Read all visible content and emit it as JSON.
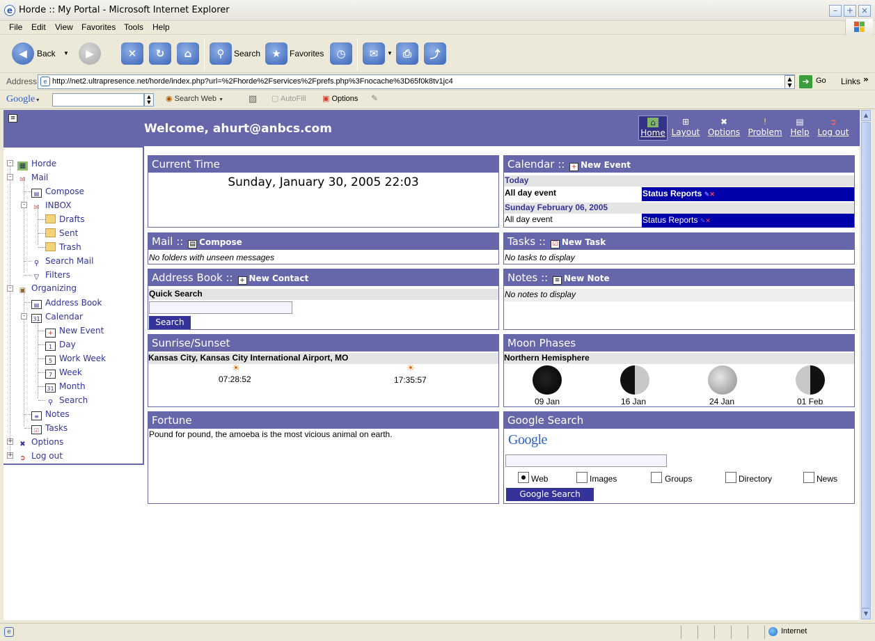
{
  "window": {
    "title": "Horde :: My Portal - Microsoft Internet Explorer"
  },
  "menu": [
    "File",
    "Edit",
    "View",
    "Favorites",
    "Tools",
    "Help"
  ],
  "toolbar": {
    "back": "Back",
    "search": "Search",
    "favorites": "Favorites"
  },
  "address": {
    "label": "Address",
    "url": "http://net2.ultrapresence.net/horde/index.php?url=%2Fhorde%2Fservices%2Fprefs.php%3Fnocache%3D65f0k8tv1jc4",
    "go": "Go",
    "links": "Links"
  },
  "googlebar": {
    "brand": "Google",
    "search_web": "Search Web",
    "autofill": "AutoFill",
    "options": "Options"
  },
  "header": {
    "welcome": "Welcome, ahurt@anbcs.com",
    "nav": [
      {
        "label": "Home",
        "icon": "home-icon"
      },
      {
        "label": "Layout",
        "icon": "layout-icon"
      },
      {
        "label": "Options",
        "icon": "options-icon"
      },
      {
        "label": "Problem",
        "icon": "problem-icon"
      },
      {
        "label": "Help",
        "icon": "help-icon"
      },
      {
        "label": "Log out",
        "icon": "logout-icon"
      }
    ]
  },
  "sidebar": {
    "items": [
      {
        "label": "Horde",
        "icon": "horde-icon"
      },
      {
        "label": "Mail",
        "icon": "mail-icon"
      },
      {
        "label": "Compose",
        "icon": "compose-icon"
      },
      {
        "label": "INBOX",
        "icon": "inbox-icon"
      },
      {
        "label": "Drafts",
        "icon": "folder-icon"
      },
      {
        "label": "Sent",
        "icon": "folder-icon"
      },
      {
        "label": "Trash",
        "icon": "folder-icon"
      },
      {
        "label": "Search Mail",
        "icon": "search-icon"
      },
      {
        "label": "Filters",
        "icon": "filter-icon"
      },
      {
        "label": "Organizing",
        "icon": "organizing-icon"
      },
      {
        "label": "Address Book",
        "icon": "address-book-icon"
      },
      {
        "label": "Calendar",
        "icon": "calendar-icon"
      },
      {
        "label": "New Event",
        "icon": "new-event-icon"
      },
      {
        "label": "Day",
        "icon": "day-icon"
      },
      {
        "label": "Work Week",
        "icon": "work-week-icon"
      },
      {
        "label": "Week",
        "icon": "week-icon"
      },
      {
        "label": "Month",
        "icon": "month-icon"
      },
      {
        "label": "Search",
        "icon": "search-icon"
      },
      {
        "label": "Notes",
        "icon": "notes-icon"
      },
      {
        "label": "Tasks",
        "icon": "tasks-icon"
      },
      {
        "label": "Options",
        "icon": "options-icon"
      },
      {
        "label": "Log out",
        "icon": "logout-icon"
      }
    ],
    "day_num": "1",
    "workweek_num": "5",
    "week_num": "7",
    "month_num": "31",
    "cal_num": "31"
  },
  "portlets": {
    "current_time": {
      "title": "Current Time",
      "value": "Sunday, January 30, 2005 22:03"
    },
    "calendar": {
      "title": "Calendar",
      "sep": "::",
      "new_event": "New Event",
      "today": "Today",
      "today_event": "All day event",
      "today_item": "Status Reports",
      "next_day": "Sunday February 06, 2005",
      "next_event": "All day event",
      "next_item": "Status Reports"
    },
    "mail": {
      "title": "Mail",
      "sep": "::",
      "compose": "Compose",
      "empty": "No folders with unseen messages"
    },
    "tasks": {
      "title": "Tasks",
      "sep": "::",
      "new_task": "New Task",
      "empty": "No tasks to display"
    },
    "address_book": {
      "title": "Address Book",
      "sep": "::",
      "new_contact": "New Contact",
      "quick_search": "Quick Search",
      "search_btn": "Search"
    },
    "notes": {
      "title": "Notes",
      "sep": "::",
      "new_note": "New Note",
      "empty": "No notes to display"
    },
    "sunrise": {
      "title": "Sunrise/Sunset",
      "location": "Kansas City, Kansas City International Airport, MO",
      "sunrise": "07:28:52",
      "sunset": "17:35:57"
    },
    "moon": {
      "title": "Moon Phases",
      "hemisphere": "Northern Hemisphere",
      "phases": [
        "09 Jan",
        "16 Jan",
        "24 Jan",
        "01 Feb"
      ]
    },
    "fortune": {
      "title": "Fortune",
      "text": "Pound for pound, the amoeba is the most vicious animal on earth."
    },
    "google": {
      "title": "Google Search",
      "logo": "Google",
      "options": [
        "Web",
        "Images",
        "Groups",
        "Directory",
        "News"
      ],
      "selected": "Web",
      "button": "Google Search"
    }
  },
  "status": {
    "zone": "Internet"
  },
  "colors": {
    "horde_purple": "#6666aa",
    "nav_active": "#333388",
    "event_blue": "#0000aa",
    "xp_bg": "#ece9d8"
  }
}
